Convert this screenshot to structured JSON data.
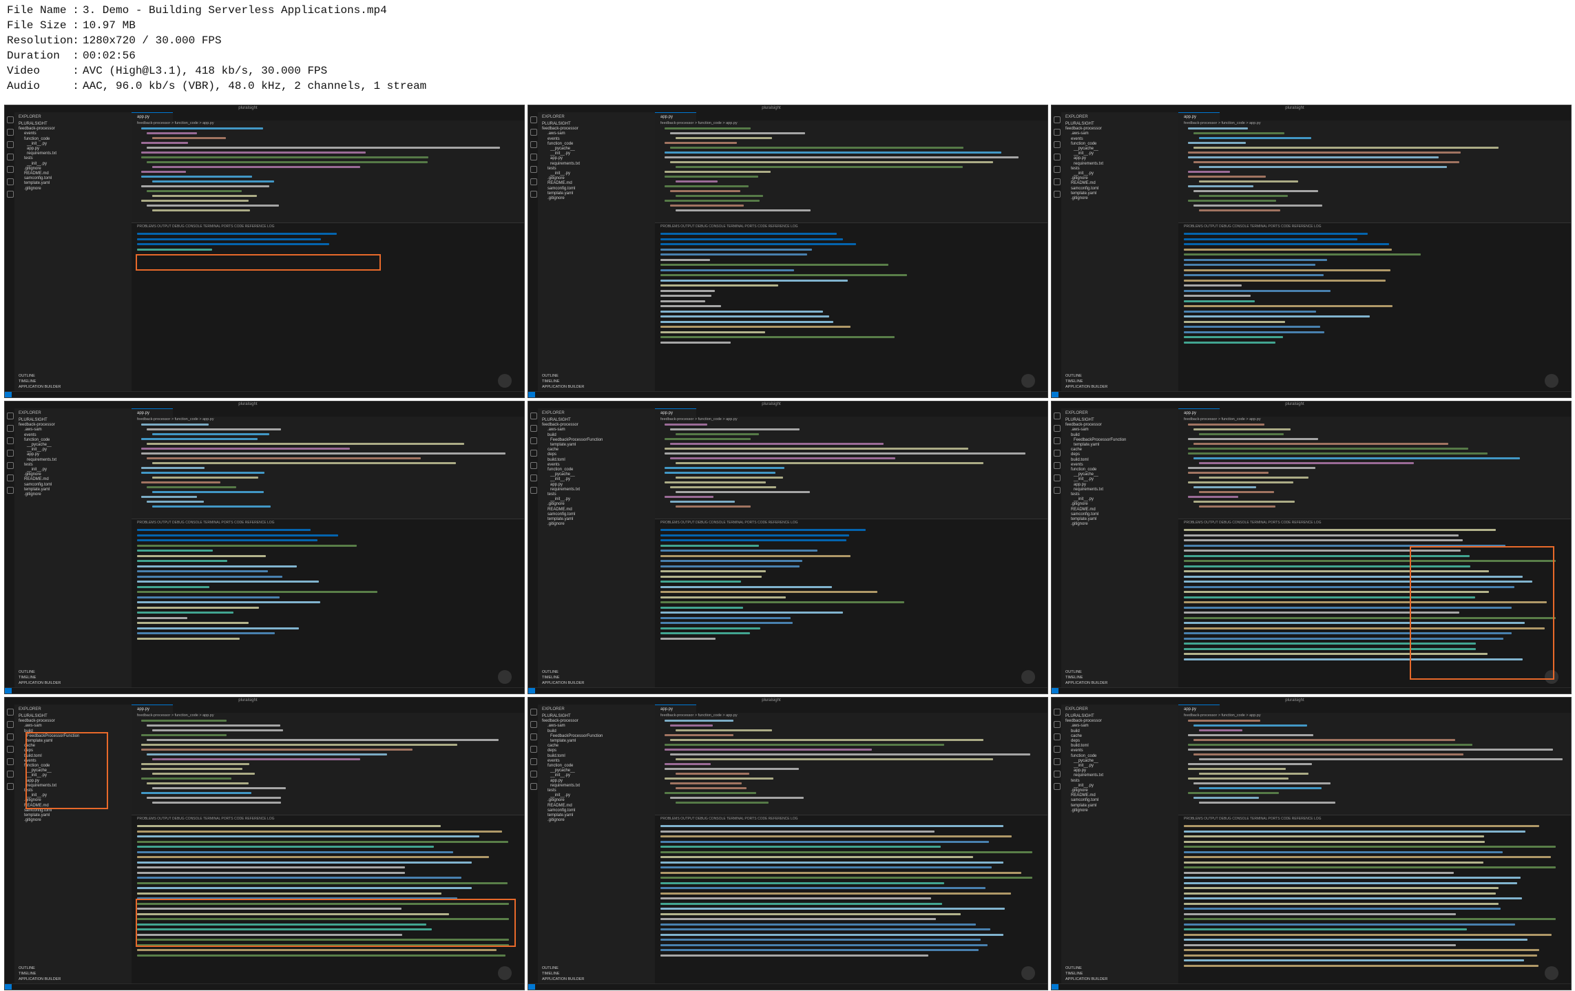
{
  "meta": {
    "rows": [
      {
        "key": "File Name",
        "value": "3. Demo - Building Serverless Applications.mp4"
      },
      {
        "key": "File Size",
        "value": "10.97 MB"
      },
      {
        "key": "Resolution",
        "value": "1280x720 / 30.000 FPS"
      },
      {
        "key": "Duration",
        "value": "00:02:56"
      },
      {
        "key": "Video",
        "value": "AVC (High@L3.1), 418 kb/s, 30.000 FPS"
      },
      {
        "key": "Audio",
        "value": "AAC, 96.0 kb/s (VBR), 48.0 kHz, 2 channels, 1 stream"
      }
    ]
  },
  "ide": {
    "window_title": "pluralsight",
    "explorer_heading": "EXPLORER",
    "tab_label": "app.py",
    "breadcrumb": "feedback-processor > function_code > app.py",
    "panel_tabs": "PROBLEMS   OUTPUT   DEBUG CONSOLE   TERMINAL   PORTS   CODE REFERENCE LOG",
    "sidebar_bottom": [
      "OUTLINE",
      "TIMELINE",
      "APPLICATION BUILDER"
    ],
    "colors": {
      "bg": "#1e1e1e",
      "accent": "#0078d4",
      "highlight": "#e8692a"
    }
  },
  "frames": [
    {
      "tree": [
        "PLURALSIGHT",
        "feedback-processor",
        "events",
        "function_code",
        "__init__.py",
        "app.py",
        "requirements.txt",
        "tests",
        "__init__.py",
        ".gitignore",
        "README.md",
        "samconfig.toml",
        "template.yaml",
        ".gitignore"
      ]
    },
    {
      "tree": [
        "PLURALSIGHT",
        "feedback-processor",
        ".aws-sam",
        "events",
        "function_code",
        "__pycache__",
        "__init__.py",
        "app.py",
        "requirements.txt",
        "tests",
        "__init__.py",
        ".gitignore",
        "README.md",
        "samconfig.toml",
        "template.yaml",
        ".gitignore"
      ]
    },
    {
      "tree": [
        "PLURALSIGHT",
        "feedback-processor",
        ".aws-sam",
        "events",
        "function_code",
        "__pycache__",
        "__init__.py",
        "app.py",
        "requirements.txt",
        "tests",
        "__init__.py",
        ".gitignore",
        "README.md",
        "samconfig.toml",
        "template.yaml",
        ".gitignore"
      ]
    },
    {
      "tree": [
        "PLURALSIGHT",
        "feedback-processor",
        ".aws-sam",
        "events",
        "function_code",
        "__pycache__",
        "__init__.py",
        "app.py",
        "requirements.txt",
        "tests",
        "__init__.py",
        ".gitignore",
        "README.md",
        "samconfig.toml",
        "template.yaml",
        ".gitignore"
      ]
    },
    {
      "tree": [
        "PLURALSIGHT",
        "feedback-processor",
        ".aws-sam",
        "build",
        "FeedbackProcessorFunction",
        "template.yaml",
        "cache",
        "deps",
        "build.toml",
        "events",
        "function_code",
        "__pycache__",
        "__init__.py",
        "app.py",
        "requirements.txt",
        "tests",
        "__init__.py",
        ".gitignore",
        "README.md",
        "samconfig.toml",
        "template.yaml",
        ".gitignore"
      ]
    },
    {
      "tree": [
        "PLURALSIGHT",
        "feedback-processor",
        ".aws-sam",
        "build",
        "FeedbackProcessorFunction",
        "template.yaml",
        "cache",
        "deps",
        "build.toml",
        "events",
        "function_code",
        "__pycache__",
        "__init__.py",
        "app.py",
        "requirements.txt",
        "tests",
        "__init__.py",
        ".gitignore",
        "README.md",
        "samconfig.toml",
        "template.yaml",
        ".gitignore"
      ]
    },
    {
      "tree": [
        "PLURALSIGHT",
        "feedback-processor",
        ".aws-sam",
        "build",
        "FeedbackProcessorFunction",
        "template.yaml",
        "cache",
        "deps",
        "build.toml",
        "events",
        "function_code",
        "__pycache__",
        "__init__.py",
        "app.py",
        "requirements.txt",
        "tests",
        "__init__.py",
        ".gitignore",
        "README.md",
        "samconfig.toml",
        "template.yaml",
        ".gitignore"
      ]
    },
    {
      "tree": [
        "PLURALSIGHT",
        "feedback-processor",
        ".aws-sam",
        "build",
        "FeedbackProcessorFunction",
        "template.yaml",
        "cache",
        "deps",
        "build.toml",
        "events",
        "function_code",
        "__pycache__",
        "__init__.py",
        "app.py",
        "requirements.txt",
        "tests",
        "__init__.py",
        ".gitignore",
        "README.md",
        "samconfig.toml",
        "template.yaml",
        ".gitignore"
      ]
    },
    {
      "tree": [
        "PLURALSIGHT",
        "feedback-processor",
        ".aws-sam",
        "build",
        "cache",
        "deps",
        "build.toml",
        "events",
        "function_code",
        "__pycache__",
        "__init__.py",
        "app.py",
        "requirements.txt",
        "tests",
        "__init__.py",
        ".gitignore",
        "README.md",
        "samconfig.toml",
        "template.yaml",
        ".gitignore"
      ]
    }
  ]
}
